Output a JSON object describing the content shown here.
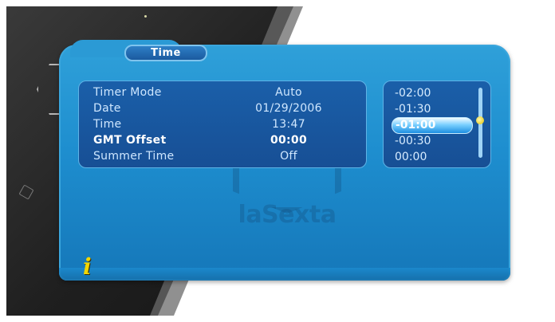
{
  "window": {
    "title": "Time"
  },
  "settings": {
    "rows": [
      {
        "label": "Timer Mode",
        "value": "Auto"
      },
      {
        "label": "Date",
        "value": "01/29/2006"
      },
      {
        "label": "Time",
        "value": "13:47"
      },
      {
        "label": "GMT Offset",
        "value": "00:00"
      },
      {
        "label": "Summer Time",
        "value": "Off"
      }
    ],
    "active_row": "GMT Offset"
  },
  "offset_list": {
    "items": [
      "-02:00",
      "-01:30",
      "-01:00",
      "-00:30",
      "00:00"
    ],
    "selected": "-01:00"
  },
  "watermark": {
    "text": "laSexta"
  },
  "icons": {
    "info": "info-icon"
  },
  "colors": {
    "panel": "#1e8ecf",
    "box": "#174f95",
    "selection": "#7ad0ff",
    "info": "#f2d600"
  }
}
